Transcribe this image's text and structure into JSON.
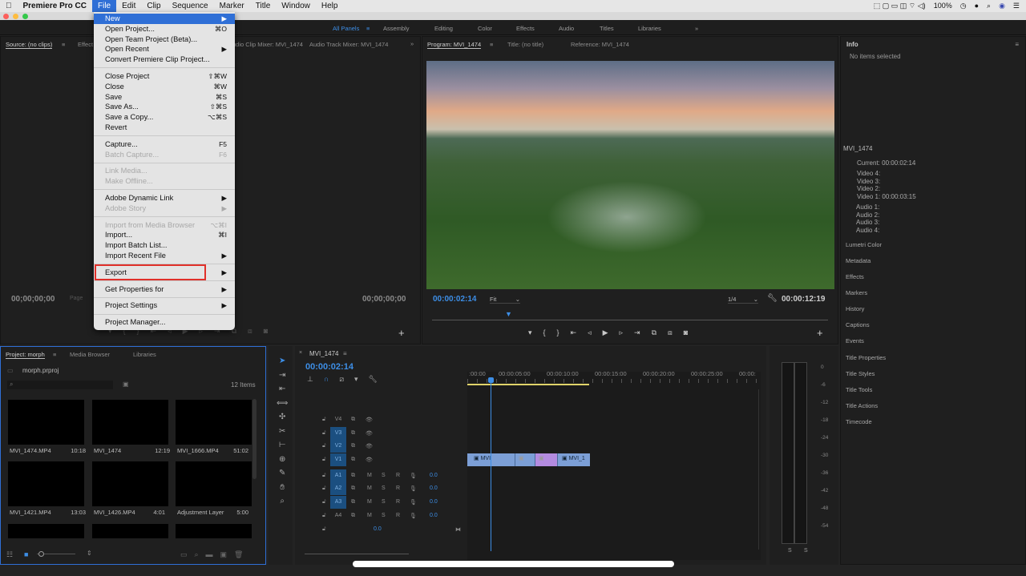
{
  "menubar": {
    "app": "Premiere Pro CC",
    "items": [
      "File",
      "Edit",
      "Clip",
      "Sequence",
      "Marker",
      "Title",
      "Window",
      "Help"
    ],
    "battery": "100%"
  },
  "workspaces": [
    "All Panels",
    "Assembly",
    "Editing",
    "Color",
    "Effects",
    "Audio",
    "Titles",
    "Libraries"
  ],
  "source": {
    "tabs": [
      "Source: (no clips)",
      "Effect",
      "Audio Clip Mixer: MVI_1474",
      "Audio Track Mixer: MVI_1474"
    ],
    "tc_left": "00;00;00;00",
    "tc_right": "00;00;00;00",
    "page": "Page"
  },
  "program": {
    "tabs": [
      "Program: MVI_1474",
      "Title: (no title)",
      "Reference: MVI_1474"
    ],
    "timecode": "00:00:02:14",
    "fit": "Fit",
    "resolution": "1/4",
    "duration": "00:00:12:19"
  },
  "file_menu": [
    {
      "label": "New",
      "shortcut": "",
      "submenu": true,
      "state": "highlighted"
    },
    {
      "label": "Open Project...",
      "shortcut": "⌘O"
    },
    {
      "label": "Open Team Project (Beta)...",
      "shortcut": ""
    },
    {
      "label": "Open Recent",
      "submenu": true
    },
    {
      "label": "Convert Premiere Clip Project...",
      "shortcut": ""
    },
    {
      "sep": true
    },
    {
      "label": "Close Project",
      "shortcut": "⇧⌘W"
    },
    {
      "label": "Close",
      "shortcut": "⌘W"
    },
    {
      "label": "Save",
      "shortcut": "⌘S"
    },
    {
      "label": "Save As...",
      "shortcut": "⇧⌘S"
    },
    {
      "label": "Save a Copy...",
      "shortcut": "⌥⌘S"
    },
    {
      "label": "Revert",
      "shortcut": ""
    },
    {
      "sep": true
    },
    {
      "label": "Capture...",
      "shortcut": "F5"
    },
    {
      "label": "Batch Capture...",
      "shortcut": "F6",
      "disabled": true
    },
    {
      "sep": true
    },
    {
      "label": "Link Media...",
      "disabled": true
    },
    {
      "label": "Make Offline...",
      "disabled": true
    },
    {
      "sep": true
    },
    {
      "label": "Adobe Dynamic Link",
      "submenu": true
    },
    {
      "label": "Adobe Story",
      "submenu": true,
      "disabled": true
    },
    {
      "sep": true
    },
    {
      "label": "Import from Media Browser",
      "shortcut": "⌥⌘I",
      "disabled": true
    },
    {
      "label": "Import...",
      "shortcut": "⌘I"
    },
    {
      "label": "Import Batch List..."
    },
    {
      "label": "Import Recent File",
      "submenu": true
    },
    {
      "sep": true
    },
    {
      "label": "Export",
      "submenu": true,
      "state": "annotated"
    },
    {
      "sep": true
    },
    {
      "label": "Get Properties for",
      "submenu": true
    },
    {
      "sep": true
    },
    {
      "label": "Project Settings",
      "submenu": true
    },
    {
      "sep": true
    },
    {
      "label": "Project Manager..."
    }
  ],
  "project": {
    "tabs": [
      "Project: morph",
      "Media Browser",
      "Libraries"
    ],
    "file": "morph.prproj",
    "count": "12 Items",
    "items": [
      {
        "name": "MVI_1474.MP4",
        "dur": "10:18"
      },
      {
        "name": "MVI_1474",
        "dur": "12:19"
      },
      {
        "name": "MVI_1666.MP4",
        "dur": "51:02"
      },
      {
        "name": "MVI_1421.MP4",
        "dur": "13:03"
      },
      {
        "name": "MVI_1426.MP4",
        "dur": "4:01"
      },
      {
        "name": "Adjustment Layer",
        "dur": "5:00"
      }
    ]
  },
  "timeline": {
    "title": "MVI_1474",
    "timecode": "00:00:02:14",
    "ruler": [
      ":00:00",
      "00:00:05:00",
      "00:00:10:00",
      "00:00:15:00",
      "00:00:20:00",
      "00:00:25:00",
      "00:00:"
    ],
    "video_tracks": [
      "V4",
      "V3",
      "V2",
      "V1"
    ],
    "audio_tracks": [
      {
        "name": "A1",
        "vol": "0.0"
      },
      {
        "name": "A2",
        "vol": "0.0"
      },
      {
        "name": "A3",
        "vol": "0.0"
      },
      {
        "name": "A4",
        "vol": "0.0"
      }
    ],
    "master_vol": "0.0",
    "clips": [
      "MVI",
      "MVI_1"
    ]
  },
  "meters": {
    "scale": [
      "0",
      "-6",
      "-12",
      "-18",
      "-24",
      "-30",
      "-36",
      "-42",
      "-48",
      "-54"
    ],
    "solo": [
      "S",
      "S"
    ]
  },
  "info": {
    "title": "Info",
    "none": "No items selected",
    "clip": "MVI_1474",
    "current": "Current:  00:00:02:14",
    "video": [
      "Video 4:",
      "Video 3:",
      "Video 2:",
      "Video 1:  00:00:03:15"
    ],
    "audio": [
      "Audio 1:",
      "Audio 2:",
      "Audio 3:",
      "Audio 4:"
    ],
    "panels": [
      "Lumetri Color",
      "Metadata",
      "Effects",
      "Markers",
      "History",
      "Captions",
      "Events",
      "Title Properties",
      "Title Styles",
      "Title Tools",
      "Title Actions",
      "Timecode"
    ]
  },
  "colors": {
    "accent": "#3d8ee6",
    "menu_highlight": "#2f6fd6",
    "annotation": "#e0302a",
    "clip_video": "#7c9fd6",
    "clip_adjust": "#b48be0"
  }
}
